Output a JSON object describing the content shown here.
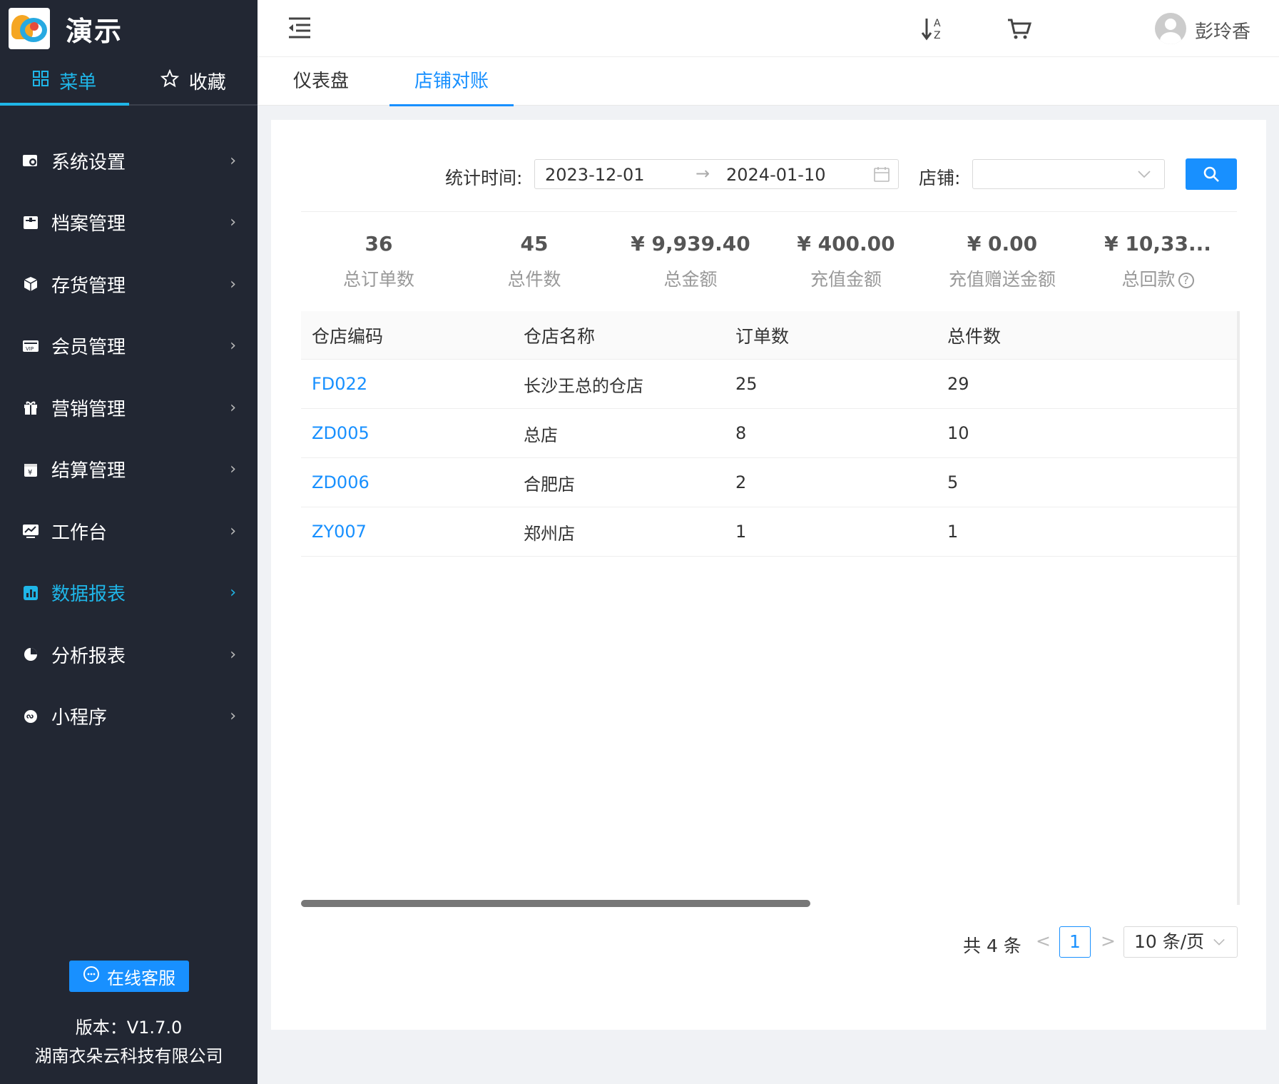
{
  "brand": {
    "name": "演示"
  },
  "side_tabs": [
    {
      "label": "菜单",
      "icon": "grid-icon",
      "active": true
    },
    {
      "label": "收藏",
      "icon": "star-icon",
      "active": false
    }
  ],
  "menu": [
    {
      "label": "系统设置",
      "icon": "settings-icon"
    },
    {
      "label": "档案管理",
      "icon": "archive-icon"
    },
    {
      "label": "存货管理",
      "icon": "box-icon"
    },
    {
      "label": "会员管理",
      "icon": "vip-card-icon"
    },
    {
      "label": "营销管理",
      "icon": "gift-icon"
    },
    {
      "label": "结算管理",
      "icon": "calendar-yen-icon"
    },
    {
      "label": "工作台",
      "icon": "monitor-chart-icon"
    },
    {
      "label": "数据报表",
      "icon": "bar-chart-icon",
      "active": true
    },
    {
      "label": "分析报表",
      "icon": "pie-chart-icon"
    },
    {
      "label": "小程序",
      "icon": "mini-program-icon"
    }
  ],
  "footer": {
    "service_label": "在线客服",
    "version": "版本：V1.7.0",
    "company": "湖南衣朵云科技有限公司"
  },
  "header": {
    "username": "彭玲香"
  },
  "page_tabs": [
    {
      "label": "仪表盘",
      "active": false
    },
    {
      "label": "店铺对账",
      "active": true
    }
  ],
  "filters": {
    "time_label": "统计时间:",
    "start_date": "2023-12-01",
    "end_date": "2024-01-10",
    "range_separator": "→",
    "store_label": "店铺:",
    "store_value": ""
  },
  "stats": [
    {
      "value": "36",
      "label": "总订单数"
    },
    {
      "value": "45",
      "label": "总件数"
    },
    {
      "value": "¥ 9,939.40",
      "label": "总金额"
    },
    {
      "value": "¥ 400.00",
      "label": "充值金额"
    },
    {
      "value": "¥ 0.00",
      "label": "充值赠送金额"
    },
    {
      "value": "¥ 10,33...",
      "label": "总回款"
    }
  ],
  "table": {
    "columns": [
      "仓店编码",
      "仓店名称",
      "订单数",
      "总件数"
    ],
    "rows": [
      {
        "code": "FD022",
        "name": "长沙王总的仓店",
        "orders": "25",
        "items": "29"
      },
      {
        "code": "ZD005",
        "name": "总店",
        "orders": "8",
        "items": "10"
      },
      {
        "code": "ZD006",
        "name": "合肥店",
        "orders": "2",
        "items": "5"
      },
      {
        "code": "ZY007",
        "name": "郑州店",
        "orders": "1",
        "items": "1"
      }
    ]
  },
  "pagination": {
    "total_text": "共 4 条",
    "prev": "<",
    "current": "1",
    "next": ">",
    "page_size": "10 条/页"
  },
  "colors": {
    "sidebar_bg": "#222733",
    "accent": "#1890ff",
    "menu_active": "#1fb6e8"
  }
}
